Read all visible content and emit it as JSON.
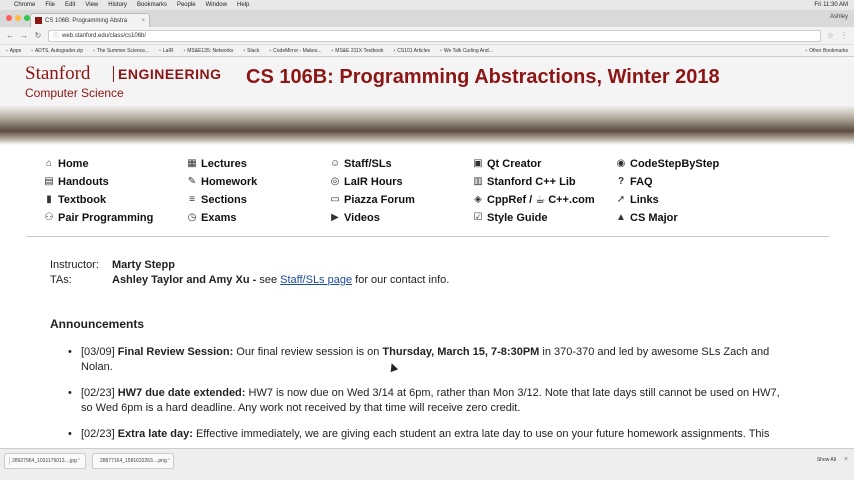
{
  "menubar": {
    "items": [
      "Chrome",
      "File",
      "Edit",
      "View",
      "History",
      "Bookmarks",
      "People",
      "Window",
      "Help"
    ],
    "clock": "Fri 11:30 AM"
  },
  "tab": {
    "title": "CS 106B: Programming Abstra",
    "close": "×"
  },
  "user": "Ashley",
  "address": {
    "url": "web.stanford.edu/class/cs106b/"
  },
  "bookmarks": {
    "items": [
      "Apps",
      "ADTS, Autograder.zip",
      "The Summer Science...",
      "LaIR",
      "MS&E135: Networks",
      "Slack",
      "CodeMirror - Makes...",
      "MS&E 211X Textbook",
      "CS101 Articles",
      "We Talk Curling And..."
    ],
    "other": "Other Bookmarks"
  },
  "header": {
    "stanford": "Stanford",
    "engineering": "ENGINEERING",
    "department": "Computer Science",
    "course_title": "CS 106B: Programming Abstractions, Winter 2018"
  },
  "nav": [
    {
      "label": "Home",
      "icon": "home-icon",
      "glyph": "⌂"
    },
    {
      "label": "Lectures",
      "icon": "calendar-icon",
      "glyph": "▦"
    },
    {
      "label": "Staff/SLs",
      "icon": "people-icon",
      "glyph": "☺"
    },
    {
      "label": "Qt Creator",
      "icon": "qt-icon",
      "glyph": "▣"
    },
    {
      "label": "CodeStepByStep",
      "icon": "code-icon",
      "glyph": "◉"
    },
    {
      "label": "Handouts",
      "icon": "document-icon",
      "glyph": "▤"
    },
    {
      "label": "Homework",
      "icon": "edit-icon",
      "glyph": "✎"
    },
    {
      "label": "LaIR Hours",
      "icon": "help-icon",
      "glyph": "◎"
    },
    {
      "label": "Stanford C++ Lib",
      "icon": "library-icon",
      "glyph": "▥"
    },
    {
      "label": "FAQ",
      "icon": "question-icon",
      "glyph": "?"
    },
    {
      "label": "Textbook",
      "icon": "book-icon",
      "glyph": "▮"
    },
    {
      "label": "Sections",
      "icon": "list-icon",
      "glyph": "≡"
    },
    {
      "label": "Piazza Forum",
      "icon": "forum-icon",
      "glyph": "▭"
    },
    {
      "label": "CppRef / ☕ C++.com",
      "icon": "reference-icon",
      "glyph": "◈"
    },
    {
      "label": "Links",
      "icon": "link-icon",
      "glyph": "➚"
    },
    {
      "label": "Pair Programming",
      "icon": "pair-icon",
      "glyph": "⚇"
    },
    {
      "label": "Exams",
      "icon": "clock-icon",
      "glyph": "◷"
    },
    {
      "label": "Videos",
      "icon": "video-icon",
      "glyph": "▶"
    },
    {
      "label": "Style Guide",
      "icon": "checkbox-icon",
      "glyph": "☑"
    },
    {
      "label": "CS Major",
      "icon": "graduation-icon",
      "glyph": "▲"
    }
  ],
  "instructor": {
    "label": "Instructor:",
    "name": "Marty Stepp"
  },
  "tas": {
    "label": "TAs:",
    "names": "Ashley Taylor and Amy Xu -",
    "pre": " see ",
    "link": "Staff/SLs page",
    "post": " for our contact info."
  },
  "announcements": {
    "title": "Announcements",
    "items": [
      {
        "date": "[03/09]",
        "title": "Final Review Session:",
        "text1": " Our final review session is on ",
        "bold": "Thursday, March 15, 7-8:30PM",
        "text2": " in 370-370 and led by awesome SLs Zach and Nolan."
      },
      {
        "date": "[02/23]",
        "title": "HW7 due date extended:",
        "text1": " HW7 is now due on Wed 3/14 at 6pm, rather than Mon 3/12. Note that late days still cannot be used on HW7, so Wed 6pm is a hard deadline. Any work not received by that time will receive zero credit.",
        "bold": "",
        "text2": ""
      },
      {
        "date": "[02/23]",
        "title": "Extra late day:",
        "text1": " Effective immediately, we are giving each student an extra late day to use on your future homework assignments. This",
        "bold": "",
        "text2": ""
      }
    ]
  },
  "downloads": {
    "files": [
      "28927964_1031179013....jpg",
      "28877164_1581632263....png"
    ],
    "show_all": "Show All"
  }
}
